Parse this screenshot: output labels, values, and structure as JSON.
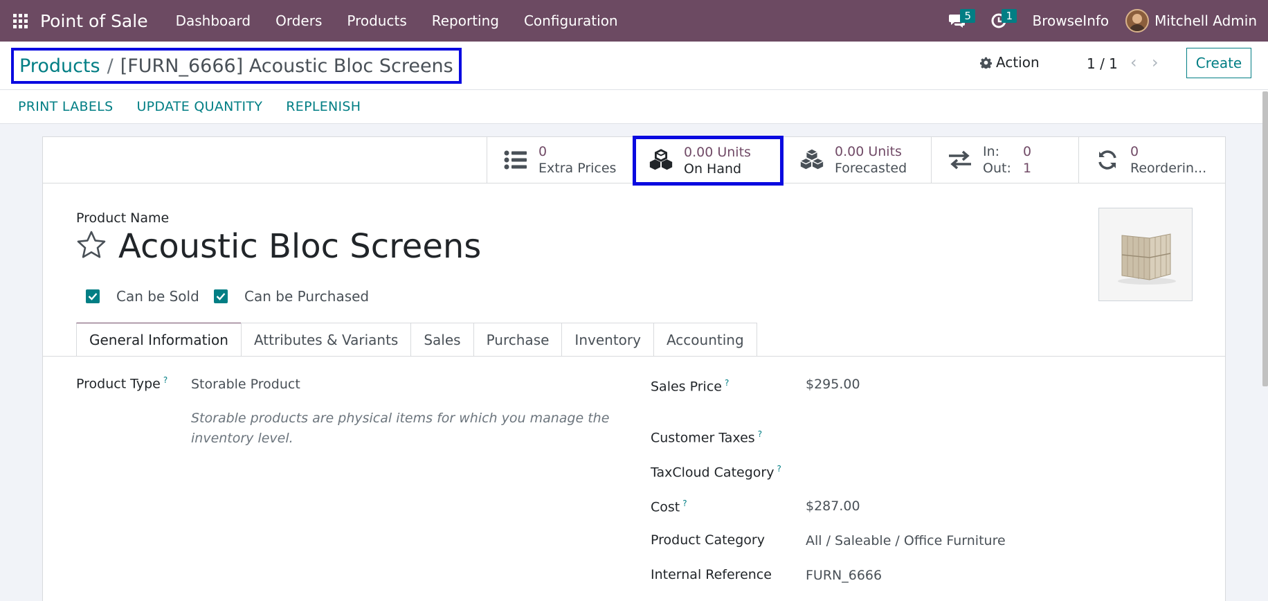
{
  "navbar": {
    "app_name": "Point of Sale",
    "menu": [
      "Dashboard",
      "Orders",
      "Products",
      "Reporting",
      "Configuration"
    ],
    "messages_badge": "5",
    "activities_badge": "1",
    "company": "BrowseInfo",
    "user": "Mitchell Admin"
  },
  "breadcrumb": {
    "parent": "Products",
    "separator": "/",
    "current": "[FURN_6666] Acoustic Bloc Screens"
  },
  "control": {
    "action_label": "Action",
    "pager": "1 / 1",
    "create_label": "Create"
  },
  "header_buttons": [
    "PRINT LABELS",
    "UPDATE QUANTITY",
    "REPLENISH"
  ],
  "stat_buttons": {
    "extra_prices": {
      "value": "0",
      "label": "Extra Prices"
    },
    "on_hand": {
      "value": "0.00 Units",
      "label": "On Hand"
    },
    "forecasted": {
      "value": "0.00 Units",
      "label": "Forecasted"
    },
    "in_out": {
      "in_label": "In:",
      "in_value": "0",
      "out_label": "Out:",
      "out_value": "1"
    },
    "reordering": {
      "value": "0",
      "label": "Reorderin..."
    }
  },
  "product": {
    "name_label": "Product Name",
    "name": "Acoustic Bloc Screens",
    "can_be_sold": "Can be Sold",
    "can_be_purchased": "Can be Purchased"
  },
  "tabs": [
    "General Information",
    "Attributes & Variants",
    "Sales",
    "Purchase",
    "Inventory",
    "Accounting"
  ],
  "general": {
    "product_type_label": "Product Type",
    "product_type": "Storable Product",
    "product_type_help": "Storable products are physical items for which you manage the inventory level.",
    "sales_price_label": "Sales Price",
    "sales_price": "$295.00",
    "customer_taxes_label": "Customer Taxes",
    "taxcloud_label": "TaxCloud Category",
    "cost_label": "Cost",
    "cost": "$287.00",
    "category_label": "Product Category",
    "category": "All / Saleable / Office Furniture",
    "internal_ref_label": "Internal Reference",
    "internal_ref": "FURN_6666",
    "help_mark": "?"
  },
  "colors": {
    "navbar": "#6c4a62",
    "accent": "#017e84",
    "stat_value": "#714b67",
    "highlight": "#0a0ae0"
  }
}
